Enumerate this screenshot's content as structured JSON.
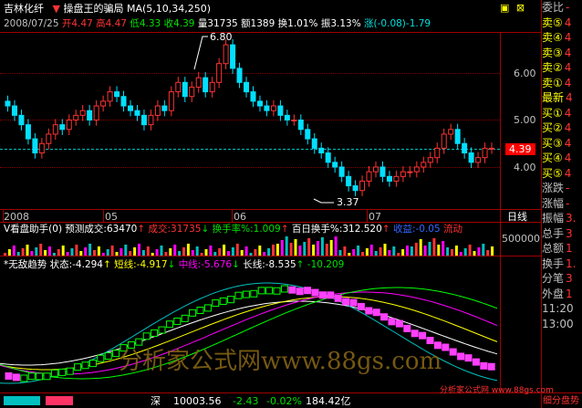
{
  "header": {
    "stock_name": "吉林化纤",
    "arrow": "▼",
    "indicator_name": "操盘王的骗局",
    "ma_label": "MA(5,10,34,250)",
    "date": "2008/07/25",
    "open": "开4.47",
    "high": "高4.47",
    "low": "低4.33",
    "close": "收4.39",
    "volume": "量31735",
    "amount": "额1389",
    "turnover": "换1.01%",
    "amplitude": "振3.13%",
    "change": "涨(-0.08)-1.79"
  },
  "price_axis": {
    "ticks": [
      "6.00",
      "5.00",
      "4.00"
    ],
    "current_price": "4.39",
    "max_label": "6.80",
    "min_label": "3.37"
  },
  "time_axis": {
    "labels": [
      "2008",
      "05",
      "06",
      "07"
    ],
    "mode": "日线"
  },
  "volume_panel": {
    "title": "V看盘助手(0)",
    "forecast": "预测成交:63470",
    "volume": "成交:31735",
    "turnover_rate": "换手率%:1.009",
    "hundred_day": "百日换手%:312.520",
    "bull": "收益:-0.05",
    "risk": "流动",
    "axis_value": "500000"
  },
  "trend_panel": {
    "title": "*无敌趋势",
    "state": "状态:-4.294",
    "short": "短线:-4.917",
    "mid": "中线:-5.676",
    "long": "长线:-8.535",
    "extra": "-10.209"
  },
  "watermark": "分析家公式网www.88gs.com",
  "watermark_small": "分析家公式网 www.88gs.com",
  "window_buttons": [
    "▣",
    "⊠"
  ],
  "sidebar": {
    "items": [
      "委比",
      "卖⑤",
      "卖④",
      "卖③",
      "卖②",
      "卖①",
      "最新",
      "买①",
      "买②",
      "买③",
      "买④",
      "买⑤",
      "涨跌",
      "涨幅",
      "振幅",
      "总手",
      "总额",
      "换手",
      "分笔",
      "外盘",
      "11:20",
      "13:00"
    ],
    "values": [
      "-",
      "4",
      "4",
      "4",
      "4",
      "4",
      "4",
      "4",
      "4",
      "4",
      "4",
      "4",
      "-",
      "-",
      "3.",
      "3",
      "1",
      "1.",
      "3",
      "1",
      "",
      ""
    ],
    "bottom": "细分盘势"
  },
  "status_bar": {
    "index": "深",
    "value": "10003.56",
    "change": "-2.43",
    "pct": "-0.02%",
    "amount": "184.42亿"
  },
  "colors": {
    "up": "#ff3333",
    "down": "#00e0ff",
    "bg": "#000000",
    "frame": "#a00000"
  }
}
